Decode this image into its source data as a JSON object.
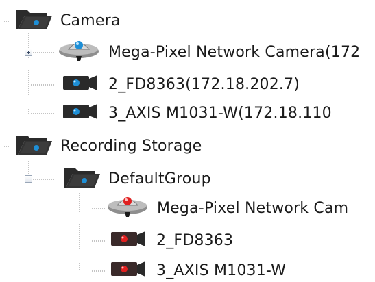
{
  "tree": {
    "camera_group": {
      "label": "Camera",
      "icon": "folder-open-icon",
      "children": [
        {
          "label": "Mega-Pixel Network Camera(172",
          "icon": "dome-camera-icon",
          "toggle": "expand"
        },
        {
          "label": "2_FD8363(172.18.202.7)",
          "icon": "box-camera-icon"
        },
        {
          "label": "3_AXIS M1031-W(172.18.110",
          "icon": "box-camera-icon"
        }
      ]
    },
    "storage_group": {
      "label": "Recording Storage",
      "icon": "folder-open-icon",
      "default_group": {
        "label": "DefaultGroup",
        "icon": "folder-open-icon",
        "toggle": "collapse",
        "children": [
          {
            "label": "Mega-Pixel Network Cam",
            "icon": "dome-camera-recording-icon"
          },
          {
            "label": "2_FD8363",
            "icon": "box-camera-recording-icon"
          },
          {
            "label": "3_AXIS M1031-W",
            "icon": "box-camera-recording-icon"
          }
        ]
      }
    }
  },
  "colors": {
    "folder": "#2b2b2b",
    "camera_lens_blue": "#1e8fd6",
    "camera_lens_red": "#e02020",
    "guide_line": "#8a8a8a"
  }
}
